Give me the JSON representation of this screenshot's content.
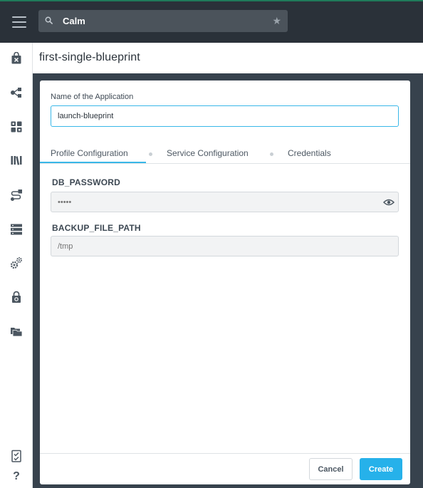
{
  "header": {
    "search_value": "Calm",
    "icons": [
      "hamburger-menu-icon",
      "search-icon",
      "star-icon"
    ]
  },
  "sidebar": {
    "items": [
      {
        "name": "marketplace-icon"
      },
      {
        "name": "applications-icon"
      },
      {
        "name": "blueprints-icon"
      },
      {
        "name": "library-icon"
      },
      {
        "name": "runbooks-icon"
      },
      {
        "name": "endpoints-icon"
      },
      {
        "name": "settings-icon"
      },
      {
        "name": "policies-icon"
      },
      {
        "name": "projects-icon"
      }
    ],
    "bottom_items": [
      {
        "name": "checklist-icon"
      },
      {
        "name": "help-icon",
        "glyph": "?"
      }
    ]
  },
  "page": {
    "title": "first-single-blueprint"
  },
  "modal": {
    "app_name_label": "Name of the Application",
    "app_name_value": "launch-blueprint",
    "tabs": [
      {
        "label": "Profile Configuration",
        "active": true
      },
      {
        "label": "Service Configuration",
        "active": false
      },
      {
        "label": "Credentials",
        "active": false
      }
    ],
    "variables": [
      {
        "label": "DB_PASSWORD",
        "placeholder": "•••••",
        "type": "password"
      },
      {
        "label": "BACKUP_FILE_PATH",
        "placeholder": "/tmp",
        "type": "text"
      }
    ],
    "cancel_label": "Cancel",
    "create_label": "Create"
  },
  "colors": {
    "accent": "#26b1ea",
    "topbar": "#2a3139",
    "backdrop": "#37424d"
  }
}
